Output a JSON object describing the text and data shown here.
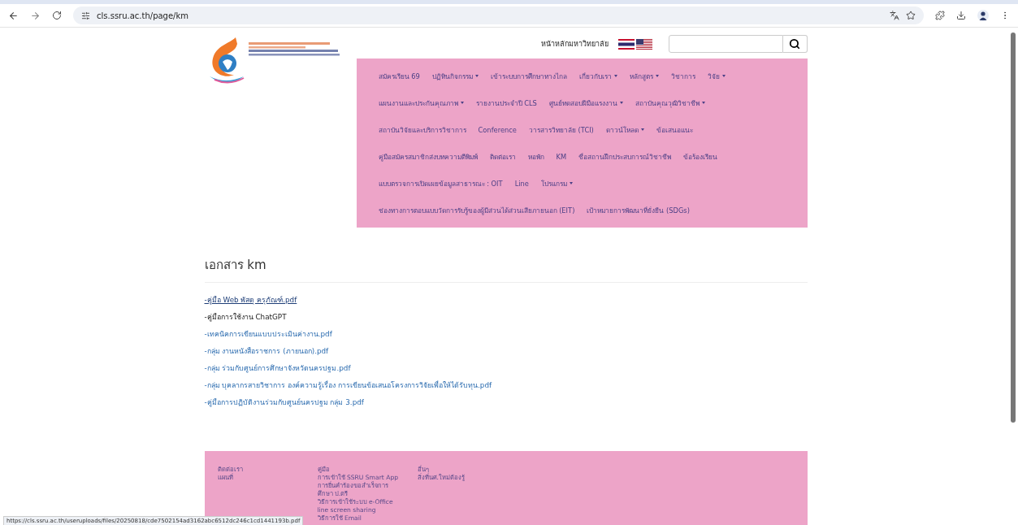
{
  "browser": {
    "url": "cls.ssru.ac.th/page/km",
    "status_url": "https://cls.ssru.ac.th/useruploads/files/20250818/cde7502154ad3162abc6512dc246c1cd1441193b.pdf"
  },
  "header": {
    "home_link": "หน้าหลักมหาวิทยาลัย"
  },
  "nav": {
    "lines": [
      {
        "items": [
          {
            "label": "สมัครเรียน 69",
            "dropdown": false
          },
          {
            "label": "ปฏิทินกิจกรรม",
            "dropdown": true
          },
          {
            "label": "เข้าระบบการศึกษาทางไกล",
            "dropdown": false
          },
          {
            "label": "เกี่ยวกับเรา",
            "dropdown": true
          },
          {
            "label": "หลักสูตร",
            "dropdown": true
          },
          {
            "label": "วิชาการ",
            "dropdown": false
          },
          {
            "label": "วิจัย",
            "dropdown": true
          }
        ]
      },
      {
        "items": [
          {
            "label": "แผนงานและประกันคุณภาพ",
            "dropdown": true
          },
          {
            "label": "รายงานประจำปี CLS",
            "dropdown": false
          },
          {
            "label": "ศูนย์ทดสอบฝีมือแรงงาน",
            "dropdown": true
          },
          {
            "label": "สถาบันคุณวุฒิวิชาชีพ",
            "dropdown": true
          }
        ]
      },
      {
        "items": [
          {
            "label": "สถาบันวิจัยและบริการวิชาการ",
            "dropdown": false
          },
          {
            "label": "Conference",
            "dropdown": false
          },
          {
            "label": "วารสารวิทยาลัย (TCI)",
            "dropdown": false
          },
          {
            "label": "ดาวน์โหลด",
            "dropdown": true
          },
          {
            "label": "ข้อเสนอแนะ",
            "dropdown": false
          }
        ]
      },
      {
        "items": [
          {
            "label": "คู่มือสมัครสมาชิกส่งบทความตีพิมพ์",
            "dropdown": false
          },
          {
            "label": "ติดต่อเรา",
            "dropdown": false
          },
          {
            "label": "หอพัก",
            "dropdown": false
          },
          {
            "label": "KM",
            "dropdown": false
          },
          {
            "label": "ชื่อสถานฝึกประสบการณ์วิชาชีพ",
            "dropdown": false
          },
          {
            "label": "ข้อร้องเรียน",
            "dropdown": false
          }
        ]
      },
      {
        "items": [
          {
            "label": "แบบตรวจการเปิดเผยข้อมูลสาธารณะ : OIT",
            "dropdown": false
          },
          {
            "label": "Line",
            "dropdown": false
          },
          {
            "label": "โปรแกรม",
            "dropdown": true
          }
        ]
      },
      {
        "items": [
          {
            "label": "ช่องทางการตอบแบบวัดการรับรู้ของผู้มีส่วนได้ส่วนเสียภายนอก (EIT)",
            "dropdown": false
          },
          {
            "label": "เป้าหมายการพัฒนาที่ยั่งยืน (SDGs)",
            "dropdown": false
          }
        ]
      }
    ]
  },
  "content": {
    "title": "เอกสาร km",
    "documents": [
      {
        "label": "-คู่มือ Web พัสดุ ครุภัณฑ์.pdf",
        "kind": "link",
        "hovered": true
      },
      {
        "label": "-คู่มือการใช้งาน ChatGPT",
        "kind": "text",
        "hovered": false
      },
      {
        "label": "-เทคนิคการเขียนแบบประเมินค่างาน.pdf",
        "kind": "link",
        "hovered": false
      },
      {
        "label": "-กลุ่ม งานหนังสือราชการ (ภายนอก).pdf",
        "kind": "link",
        "hovered": false
      },
      {
        "label": "-กลุ่ม ร่วมกับศูนย์การศึกษาจังหวัดนครปฐม.pdf",
        "kind": "link",
        "hovered": false
      },
      {
        "label": "-กลุ่ม บุคลากรสายวิชาการ องค์ความรู้เรื่อง การเขียนข้อเสนอโครงการวิจัยเพื่อให้ได้รับทุน.pdf",
        "kind": "link",
        "hovered": false
      },
      {
        "label": "-คู่มือการปฏิบัติงานร่วมกับศูนย์นครปฐม กลุ่ม 3.pdf",
        "kind": "link",
        "hovered": false
      }
    ]
  },
  "footer": {
    "columns": [
      {
        "title": "ติดต่อเรา",
        "items": [
          "แผนที่"
        ]
      },
      {
        "title": "คู่มือ",
        "items": [
          "การเข้าใช้ SSRU Smart App",
          "การยื่นคำร้องขอสำเร็จการ",
          "ศึกษา ป.ตรี",
          "วิธีการเข้าใช้ระบบ e-Office",
          "line screen sharing",
          "วิธีการใช้ Email"
        ]
      },
      {
        "title": "อื่นๆ",
        "items": [
          "สิ่งที่นศ.ใหม่ต้องรู้"
        ]
      }
    ]
  }
}
